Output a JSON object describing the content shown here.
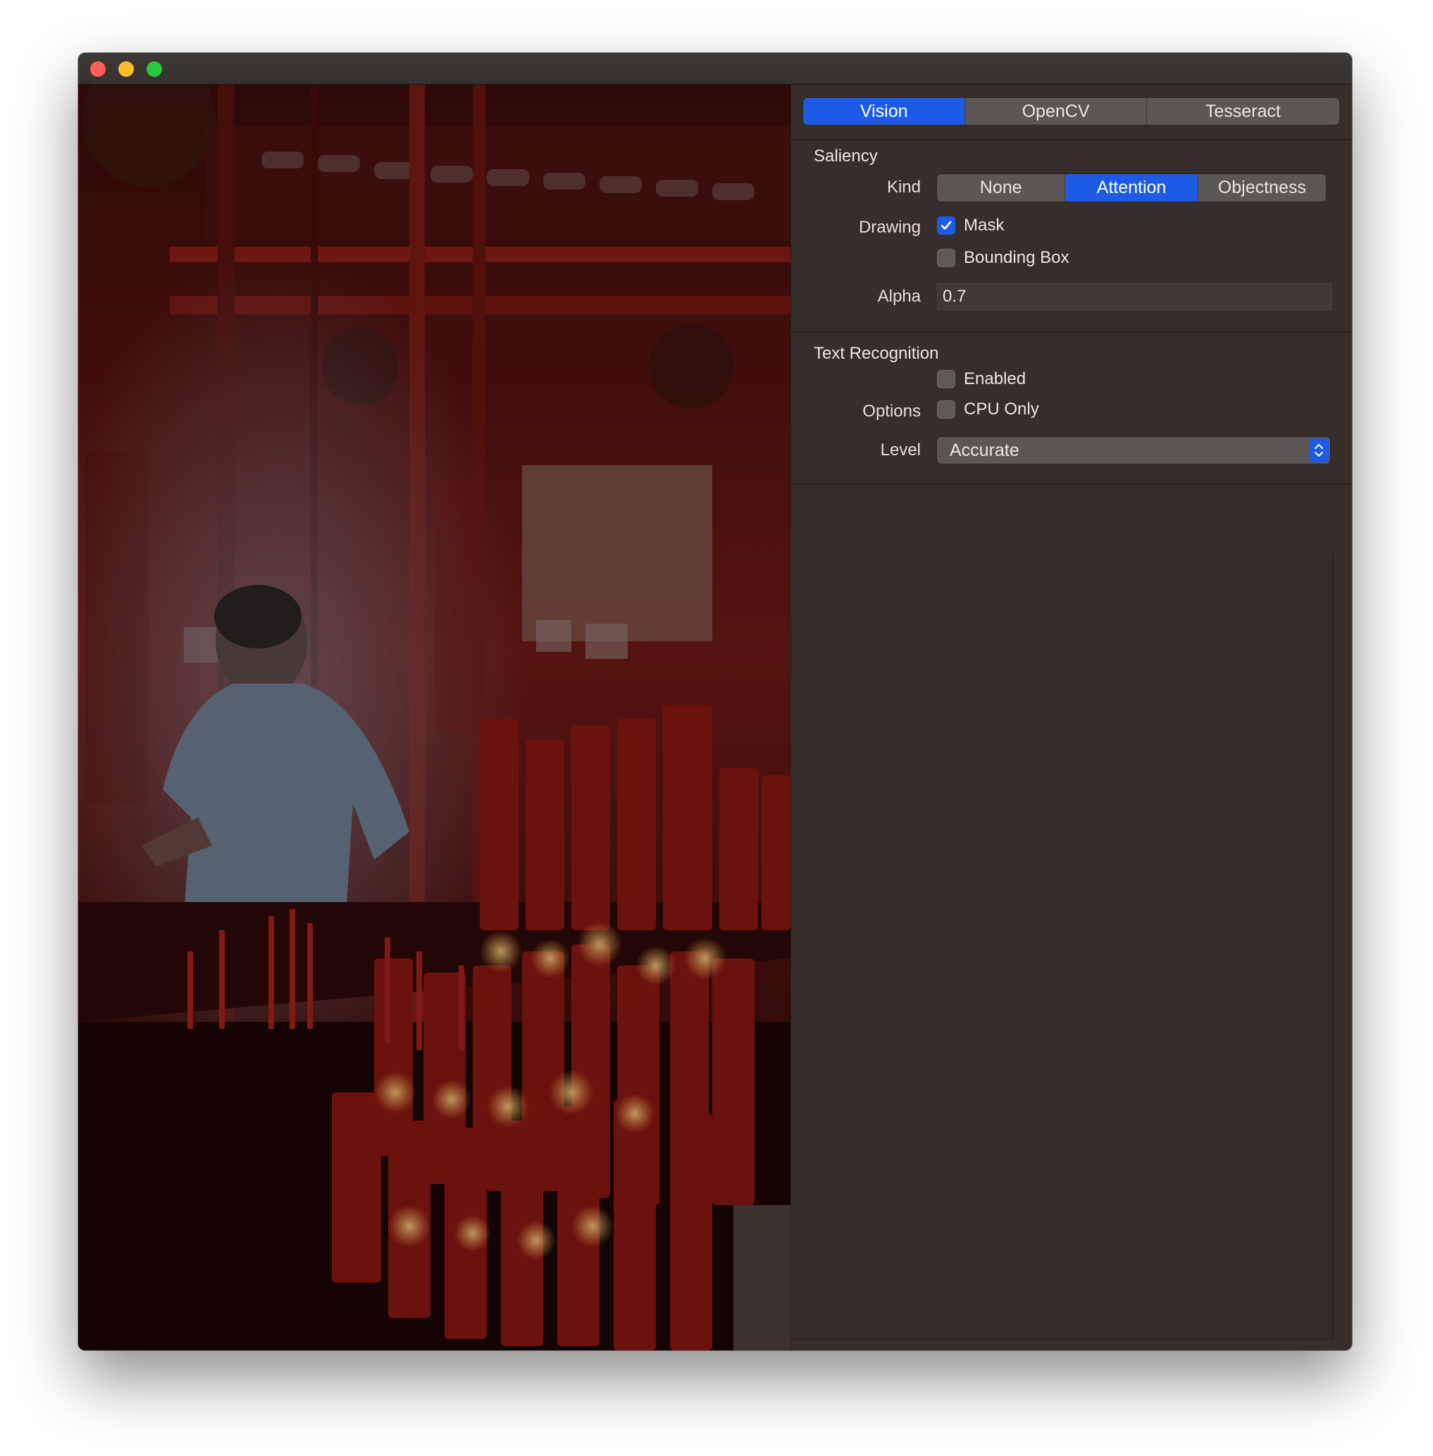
{
  "window": {
    "controls": {
      "close_icon": "close-icon",
      "minimize_icon": "minimize-icon",
      "zoom_icon": "zoom-icon"
    }
  },
  "tabs": [
    {
      "label": "Vision",
      "active": true
    },
    {
      "label": "OpenCV",
      "active": false
    },
    {
      "label": "Tesseract",
      "active": false
    }
  ],
  "saliency": {
    "title": "Saliency",
    "kind_label": "Kind",
    "kind_options": [
      {
        "label": "None",
        "active": false
      },
      {
        "label": "Attention",
        "active": true
      },
      {
        "label": "Objectness",
        "active": false
      }
    ],
    "drawing_label": "Drawing",
    "mask_label": "Mask",
    "mask_checked": true,
    "bounding_box_label": "Bounding Box",
    "bounding_box_checked": false,
    "alpha_label": "Alpha",
    "alpha_value": "0.7"
  },
  "text_recognition": {
    "title": "Text Recognition",
    "enabled_label": "Enabled",
    "enabled_checked": false,
    "options_label": "Options",
    "cpu_only_label": "CPU Only",
    "cpu_only_checked": false,
    "level_label": "Level",
    "level_value": "Accurate"
  },
  "colors": {
    "accent": "#1d5be6",
    "panel_bg": "#352e2b",
    "traffic_close": "#fe5f57",
    "traffic_minimize": "#febc2e",
    "traffic_zoom": "#28c840"
  }
}
